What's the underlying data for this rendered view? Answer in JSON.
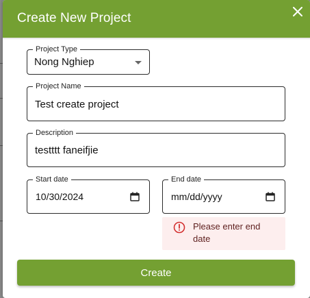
{
  "dialog": {
    "title": "Create New Project"
  },
  "form": {
    "project_type": {
      "label": "Project Type",
      "value": "Nong Nghiep"
    },
    "project_name": {
      "label": "Project Name",
      "value": "Test create project"
    },
    "description": {
      "label": "Description",
      "value": "testttt faneifjie"
    },
    "start_date": {
      "label": "Start date",
      "value": "10/30/2024"
    },
    "end_date": {
      "label": "End date",
      "value": "mm/dd/yyyy"
    },
    "end_date_error": "Please enter end date"
  },
  "actions": {
    "create_label": "Create"
  },
  "colors": {
    "brand": "#74a032",
    "error_bg": "#fdeeee",
    "error_icon": "#d32f2f"
  }
}
